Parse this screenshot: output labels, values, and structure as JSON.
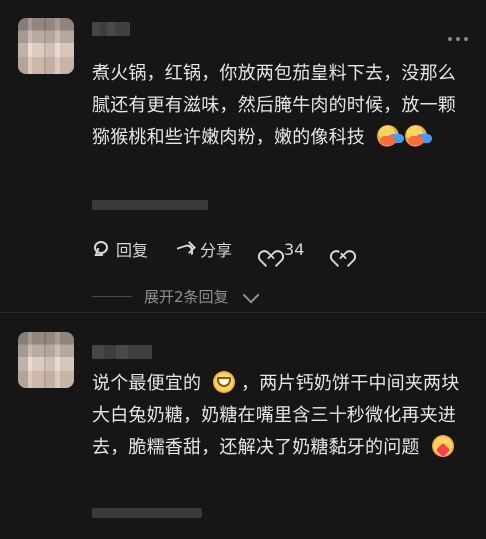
{
  "comments": [
    {
      "text": "煮火锅，红锅，你放两包茄皇料下去，没那么腻还有更有滋味，然后腌牛肉的时候，放一颗猕猴桃和些许嫩肉粉，嫩的像科技",
      "emoji_1": "hug-emoji",
      "emoji_2": "hug-emoji",
      "actions": {
        "reply": "回复",
        "share": "分享",
        "likes": "34"
      },
      "expand": "展开2条回复"
    },
    {
      "text_part_1": "说个最便宜的",
      "text_part_2": "，两片钙奶饼干中间夹两块大白兔奶糖，奶糖在嘴里含三十秒微化再夹进去，脆糯香甜，还解决了奶糖黏牙的问题",
      "emoji_1": "grin-emoji",
      "emoji_2": "heart-eyes-emoji"
    }
  ],
  "colors": {
    "background": "#161616",
    "text": "#e6e6e6",
    "muted": "#8f8f8f"
  }
}
